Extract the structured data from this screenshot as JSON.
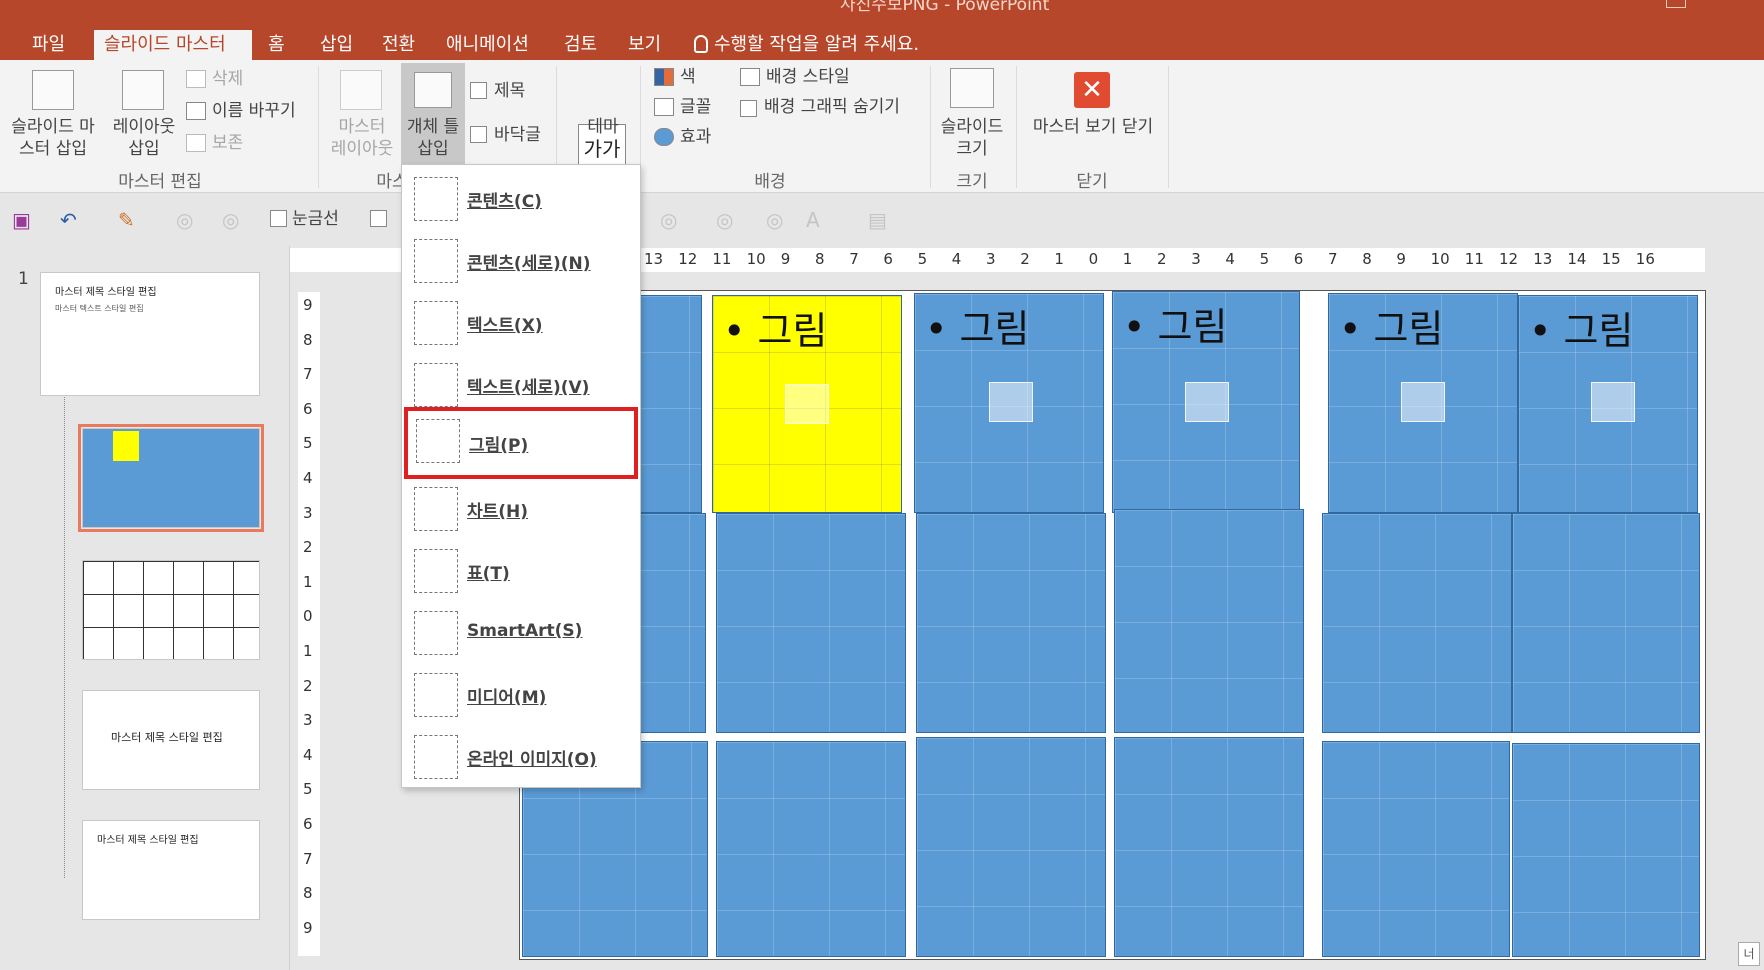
{
  "window": {
    "title": "사진수보PNG - PowerPoint"
  },
  "tabs": [
    {
      "label": "파일"
    },
    {
      "label": "슬라이드 마스터"
    },
    {
      "label": "홈"
    },
    {
      "label": "삽입"
    },
    {
      "label": "전환"
    },
    {
      "label": "애니메이션"
    },
    {
      "label": "검토"
    },
    {
      "label": "보기"
    }
  ],
  "tell_me": "수행할 작업을 알려 주세요.",
  "ribbon": {
    "master_edit": {
      "insert_master_l1": "슬라이드 마",
      "insert_master_l2": "스터 삽입",
      "insert_layout_l1": "레이아웃",
      "insert_layout_l2": "삽입",
      "delete": "삭제",
      "rename": "이름 바꾸기",
      "preserve": "보존",
      "group": "마스터 편집"
    },
    "master_layout": {
      "master_layout_l1": "마스터",
      "master_layout_l2": "레이아웃",
      "insert_placeholder_l1": "개체 틀",
      "insert_placeholder_l2": "삽입",
      "title_cb": "제목",
      "footer_cb": "바닥글",
      "group": "마스"
    },
    "edit_theme": {
      "theme": "테마",
      "theme_icon": "가가"
    },
    "background": {
      "colors": "색",
      "fonts": "글꼴",
      "effects": "효과",
      "bg_styles": "배경 스타일",
      "hide_bg": "배경 그래픽 숨기기",
      "group": "배경"
    },
    "size": {
      "slide_size_l1": "슬라이드",
      "slide_size_l2": "크기",
      "group": "크기"
    },
    "close": {
      "close_label": "마스터 보기 닫기",
      "group": "닫기"
    }
  },
  "qat": {
    "gridlines": "눈금선"
  },
  "slide_panel": {
    "slide_number": "1",
    "master_title": "마스터 제목 스타일 편집",
    "master_text": "마스터 텍스트 스타일 편집",
    "layout_title": "마스터 제목 스타일 편집"
  },
  "placeholder_label": "• 그림",
  "insert_menu": {
    "items": [
      {
        "label": "콘텐츠(C)"
      },
      {
        "label": "콘텐츠(세로)(N)"
      },
      {
        "label": "텍스트(X)"
      },
      {
        "label": "텍스트(세로)(V)"
      },
      {
        "label": "그림(P)"
      },
      {
        "label": "차트(H)"
      },
      {
        "label": "표(T)"
      },
      {
        "label": "SmartArt(S)"
      },
      {
        "label": "미디어(M)"
      },
      {
        "label": "온라인 이미지(O)"
      }
    ]
  },
  "ruler": {
    "h_ticks": [
      "13",
      "12",
      "11",
      "10",
      "9",
      "8",
      "7",
      "6",
      "5",
      "4",
      "3",
      "2",
      "1",
      "0",
      "1",
      "2",
      "3",
      "4",
      "5",
      "6",
      "7",
      "8",
      "9",
      "10",
      "11",
      "12",
      "13",
      "14",
      "15",
      "16"
    ],
    "v_ticks": [
      "9",
      "8",
      "7",
      "6",
      "5",
      "4",
      "3",
      "2",
      "1",
      "0",
      "1",
      "2",
      "3",
      "4",
      "5",
      "6",
      "7",
      "8",
      "9"
    ]
  },
  "colors": {
    "accent": "#b7472a",
    "placeholder_blue": "#5b9bd5",
    "highlight_yellow": "#ffff00",
    "menu_highlight": "#e02020"
  },
  "status": {
    "corner": "너"
  }
}
